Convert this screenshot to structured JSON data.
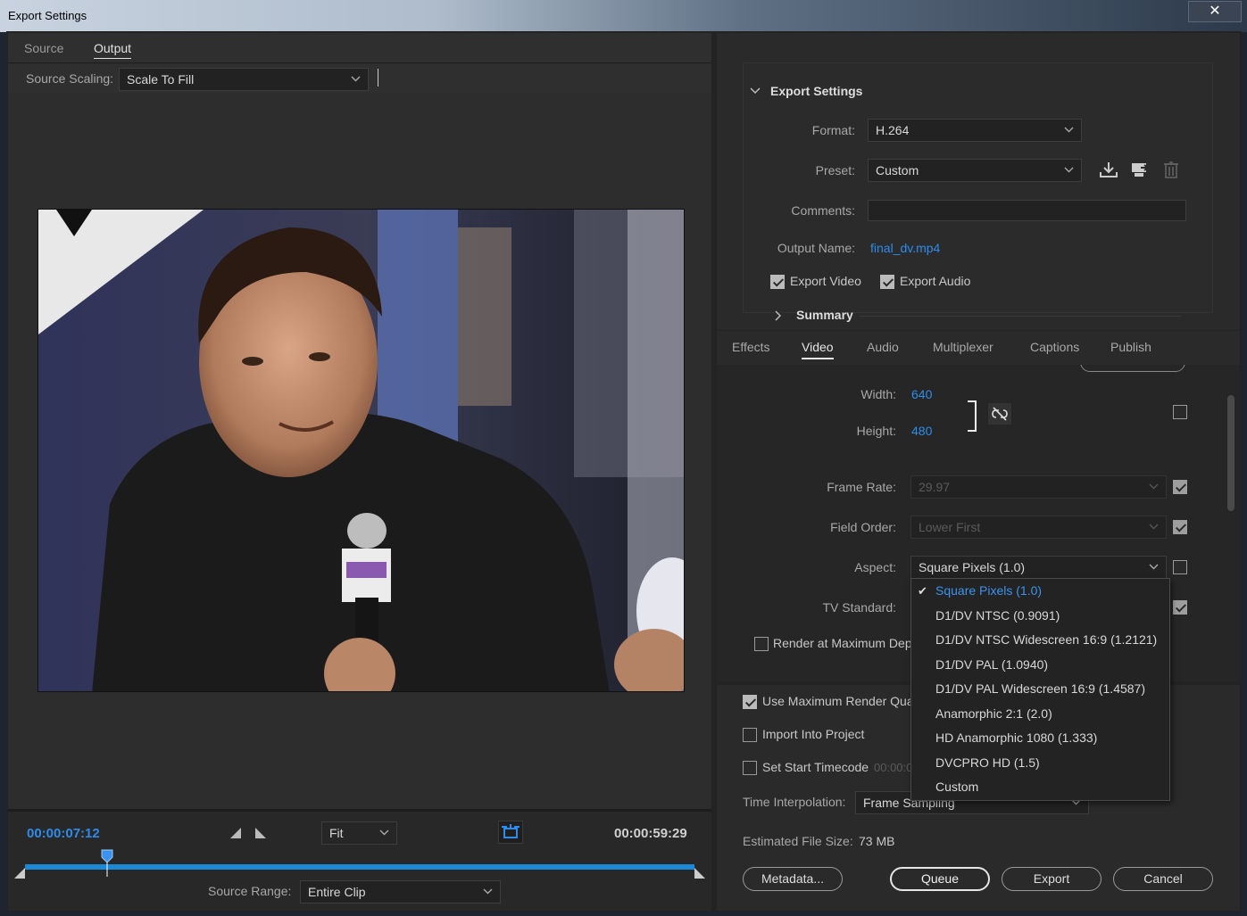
{
  "window": {
    "title": "Export Settings",
    "close_label": "✕"
  },
  "left": {
    "tabs": [
      {
        "label": "Source"
      },
      {
        "label": "Output"
      }
    ],
    "active_tab": "Output",
    "source_scaling": {
      "label": "Source Scaling:",
      "value": "Scale To Fill"
    },
    "timeline": {
      "current_time": "00:00:07:12",
      "end_time": "00:00:59:29",
      "zoom": "Fit",
      "playhead_fraction": 0.123
    },
    "source_range": {
      "label": "Source Range:",
      "value": "Entire Clip"
    }
  },
  "export_settings": {
    "section_title": "Export Settings",
    "format": {
      "label": "Format:",
      "value": "H.264"
    },
    "preset": {
      "label": "Preset:",
      "value": "Custom"
    },
    "comments": {
      "label": "Comments:",
      "value": ""
    },
    "output_name": {
      "label": "Output Name:",
      "value": "final_dv.mp4"
    },
    "export_video": {
      "label": "Export Video",
      "checked": true
    },
    "export_audio": {
      "label": "Export Audio",
      "checked": true
    },
    "summary_label": "Summary"
  },
  "tabs": [
    {
      "label": "Effects"
    },
    {
      "label": "Video"
    },
    {
      "label": "Audio"
    },
    {
      "label": "Multiplexer"
    },
    {
      "label": "Captions"
    },
    {
      "label": "Publish"
    }
  ],
  "active_settings_tab": "Video",
  "video": {
    "width": {
      "label": "Width:",
      "value": "640"
    },
    "height": {
      "label": "Height:",
      "value": "480"
    },
    "frame_rate": {
      "label": "Frame Rate:",
      "value": "29.97"
    },
    "field_order": {
      "label": "Field Order:",
      "value": "Lower First"
    },
    "aspect": {
      "label": "Aspect:",
      "value": "Square Pixels (1.0)"
    },
    "tv_standard": {
      "label": "TV Standard:"
    },
    "render_max_depth": {
      "label": "Render at Maximum Dept"
    }
  },
  "aspect_menu": {
    "items": [
      "Square Pixels (1.0)",
      "D1/DV NTSC (0.9091)",
      "D1/DV NTSC Widescreen 16:9 (1.2121)",
      "D1/DV PAL (1.0940)",
      "D1/DV PAL Widescreen 16:9 (1.4587)",
      "Anamorphic 2:1 (2.0)",
      "HD Anamorphic 1080 (1.333)",
      "DVCPRO HD (1.5)",
      "Custom"
    ],
    "selected": "Square Pixels (1.0)"
  },
  "bottom": {
    "use_max_render_quality": {
      "label": "Use Maximum Render Qua",
      "checked": true
    },
    "import_into_project": {
      "label": "Import Into Project",
      "checked": false
    },
    "set_start_timecode": {
      "label": "Set Start Timecode",
      "value": "00:00:0",
      "checked": false
    },
    "time_interpolation": {
      "label": "Time Interpolation:",
      "value": "Frame Sampling"
    },
    "estimated_file_size": {
      "label": "Estimated File Size:",
      "value": "73 MB"
    },
    "buttons": {
      "metadata": "Metadata...",
      "queue": "Queue",
      "export": "Export",
      "cancel": "Cancel"
    }
  },
  "colors": {
    "accent_blue": "#2d8ceb",
    "panel_bg": "#2b2b2b"
  }
}
